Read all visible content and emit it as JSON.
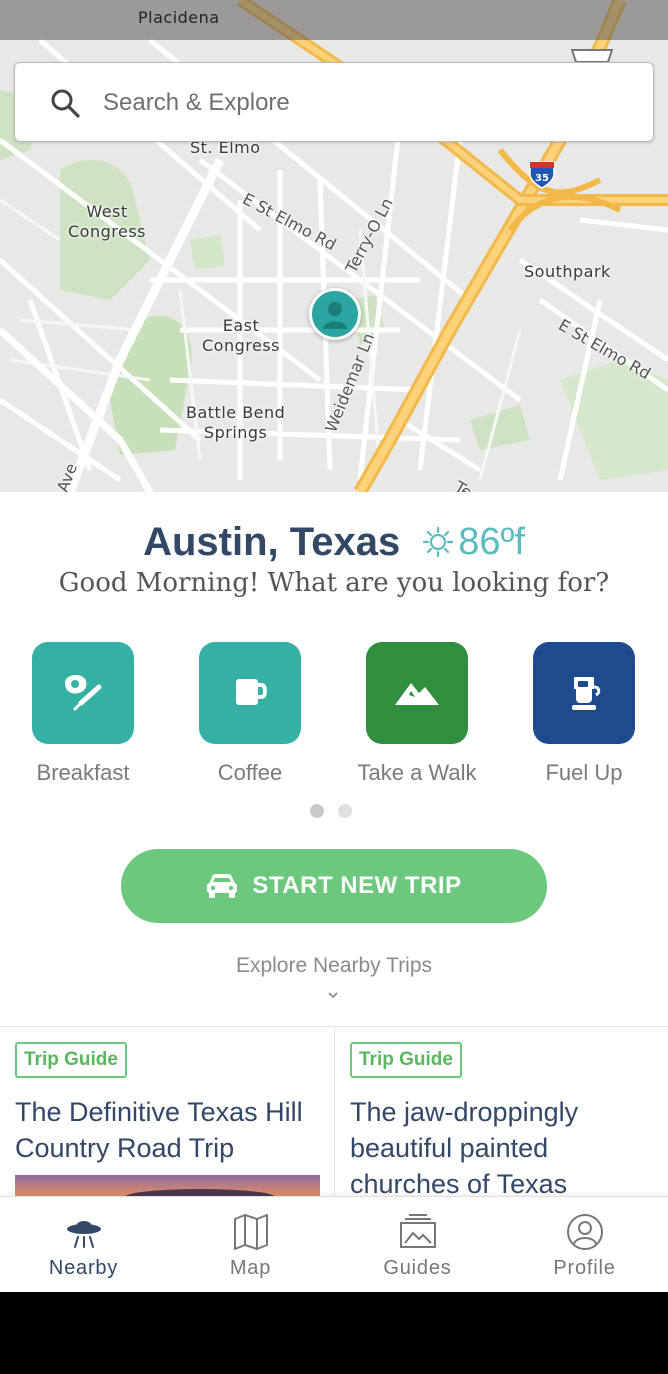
{
  "map": {
    "labels": {
      "placidena": "Placidena",
      "st_elmo": "St. Elmo",
      "west_congress": "West\nCongress",
      "east_congress": "East\nCongress",
      "battle_bend": "Battle Bend\nSprings",
      "southpark": "Southpark"
    },
    "streets": {
      "e_st_elmo_rd_1": "E St Elmo Rd",
      "terry_o_ln": "Terry-O Ln",
      "e_st_elmo_rd_2": "E St Elmo Rd",
      "weidemar_ln": "Weidemar Ln",
      "ave": "Ave",
      "te": "Te"
    },
    "interstate": "35"
  },
  "search": {
    "placeholder": "Search & Explore"
  },
  "location": {
    "city": "Austin, Texas",
    "temperature": "86ºf"
  },
  "greeting": "Good Morning! What are you looking for?",
  "categories": [
    {
      "label": "Breakfast",
      "color": "#36b0a4",
      "icon": "egg-spatula-icon"
    },
    {
      "label": "Coffee",
      "color": "#36b0a4",
      "icon": "mug-icon"
    },
    {
      "label": "Take a Walk",
      "color": "#2f8f3f",
      "icon": "mountain-icon"
    },
    {
      "label": "Fuel Up",
      "color": "#1e4a8e",
      "icon": "fuel-pump-icon"
    }
  ],
  "start_trip": {
    "label": "START NEW TRIP"
  },
  "explore_nearby": "Explore Nearby Trips",
  "cards": [
    {
      "tag": "Trip Guide",
      "title": "The Definitive Texas Hill Country Road Trip"
    },
    {
      "tag": "Trip Guide",
      "title": "The jaw-droppingly beautiful painted churches of Texas"
    }
  ],
  "nav": [
    {
      "label": "Nearby",
      "icon": "ufo-icon",
      "active": true
    },
    {
      "label": "Map",
      "icon": "map-icon",
      "active": false
    },
    {
      "label": "Guides",
      "icon": "guides-icon",
      "active": false
    },
    {
      "label": "Profile",
      "icon": "profile-icon",
      "active": false
    }
  ],
  "colors": {
    "primary_text": "#334766",
    "accent_green": "#6cc87c",
    "teal": "#36b0a4",
    "weather": "#5bbcc0"
  }
}
